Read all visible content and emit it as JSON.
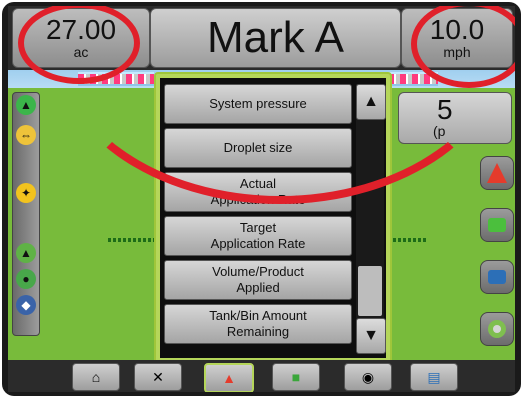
{
  "topbar": {
    "left_value": "27.00",
    "left_unit": "ac",
    "title": "Mark A",
    "right_value": "10.0",
    "right_unit": "mph"
  },
  "right_panel": {
    "value": "5",
    "unit": "(p"
  },
  "menu": {
    "items": [
      {
        "label": "System pressure"
      },
      {
        "label": "Droplet size"
      },
      {
        "label": "Actual\nApplication Rate"
      },
      {
        "label": "Target\nApplication Rate"
      },
      {
        "label": "Volume/Product\nApplied"
      },
      {
        "label": "Tank/Bin Amount\nRemaining"
      }
    ],
    "scroll_up_icon": "triangle-up",
    "scroll_down_icon": "triangle-down"
  },
  "bottom_nav": [
    {
      "icon": "home-icon"
    },
    {
      "icon": "tools-icon"
    },
    {
      "icon": "guidance-icon"
    },
    {
      "icon": "map-icon"
    },
    {
      "icon": "camera-icon"
    },
    {
      "icon": "data-icon"
    }
  ],
  "colors": {
    "highlight_ring": "#e0202a",
    "menu_border": "#b5d65a",
    "field": "#78bb3b"
  }
}
